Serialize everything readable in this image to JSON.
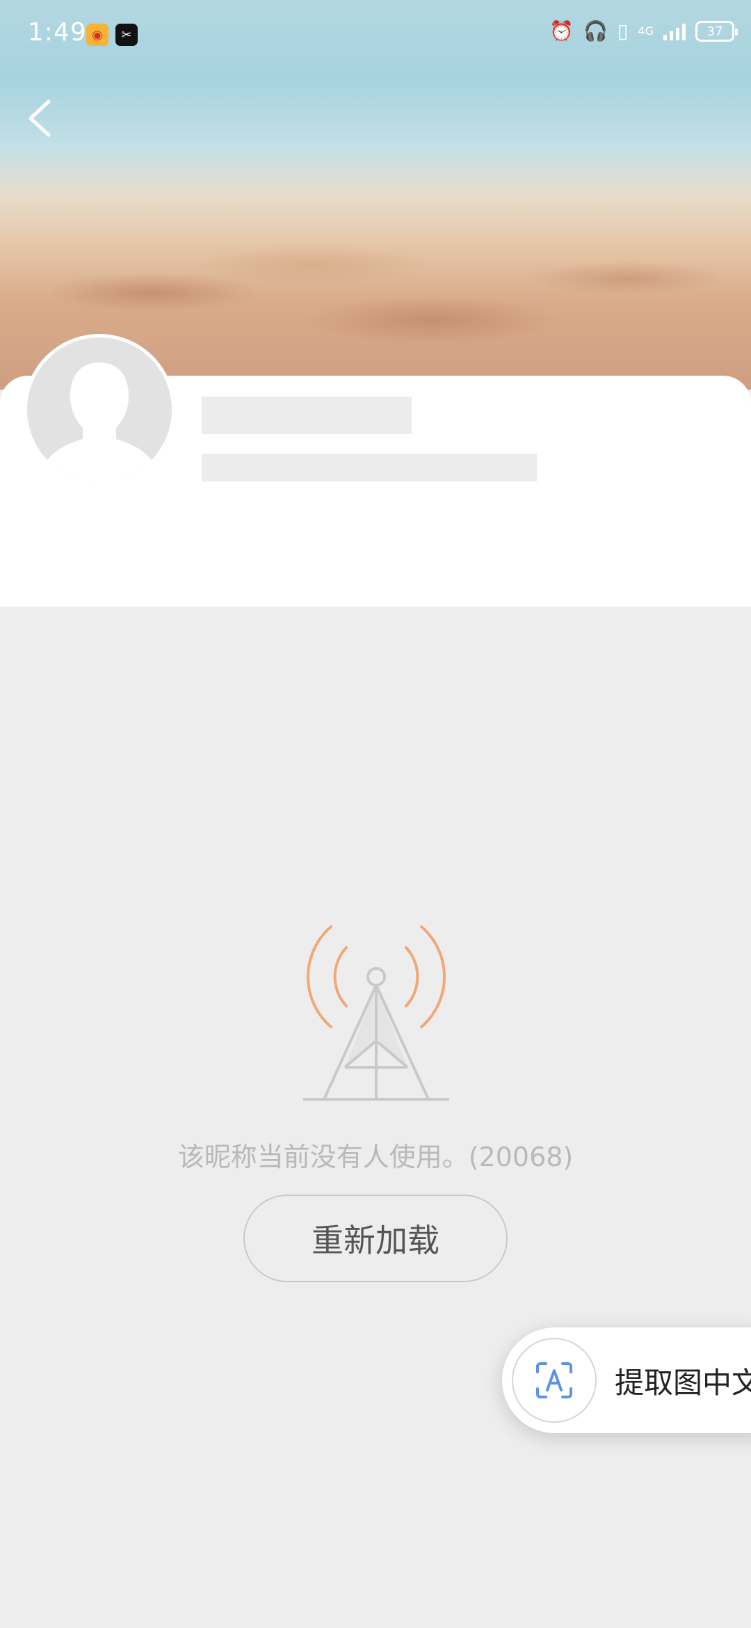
{
  "status_bar": {
    "time": "1:49",
    "app_icons": [
      "weibo-icon",
      "capcut-icon"
    ],
    "indicators": [
      "alarm-icon",
      "headphones-icon",
      "vibrate-icon",
      "signal-4g-icon"
    ],
    "network_label": "4G",
    "battery": "37"
  },
  "header": {
    "back_icon": "chevron-left-icon"
  },
  "profile": {
    "avatar_icon": "default-avatar-icon"
  },
  "error": {
    "icon": "signal-tower-icon",
    "message": "该昵称当前没有人使用。(20068)",
    "reload_label": "重新加载"
  },
  "ocr_button": {
    "icon": "text-scan-icon",
    "label": "提取图中文"
  },
  "colors": {
    "page_bg": "#ededed",
    "card_bg": "#ffffff",
    "tower_wave": "#f0a878",
    "tower_body": "#c9c9c9",
    "message_text": "#b9b9b9",
    "ocr_accent": "#5b93e6"
  }
}
